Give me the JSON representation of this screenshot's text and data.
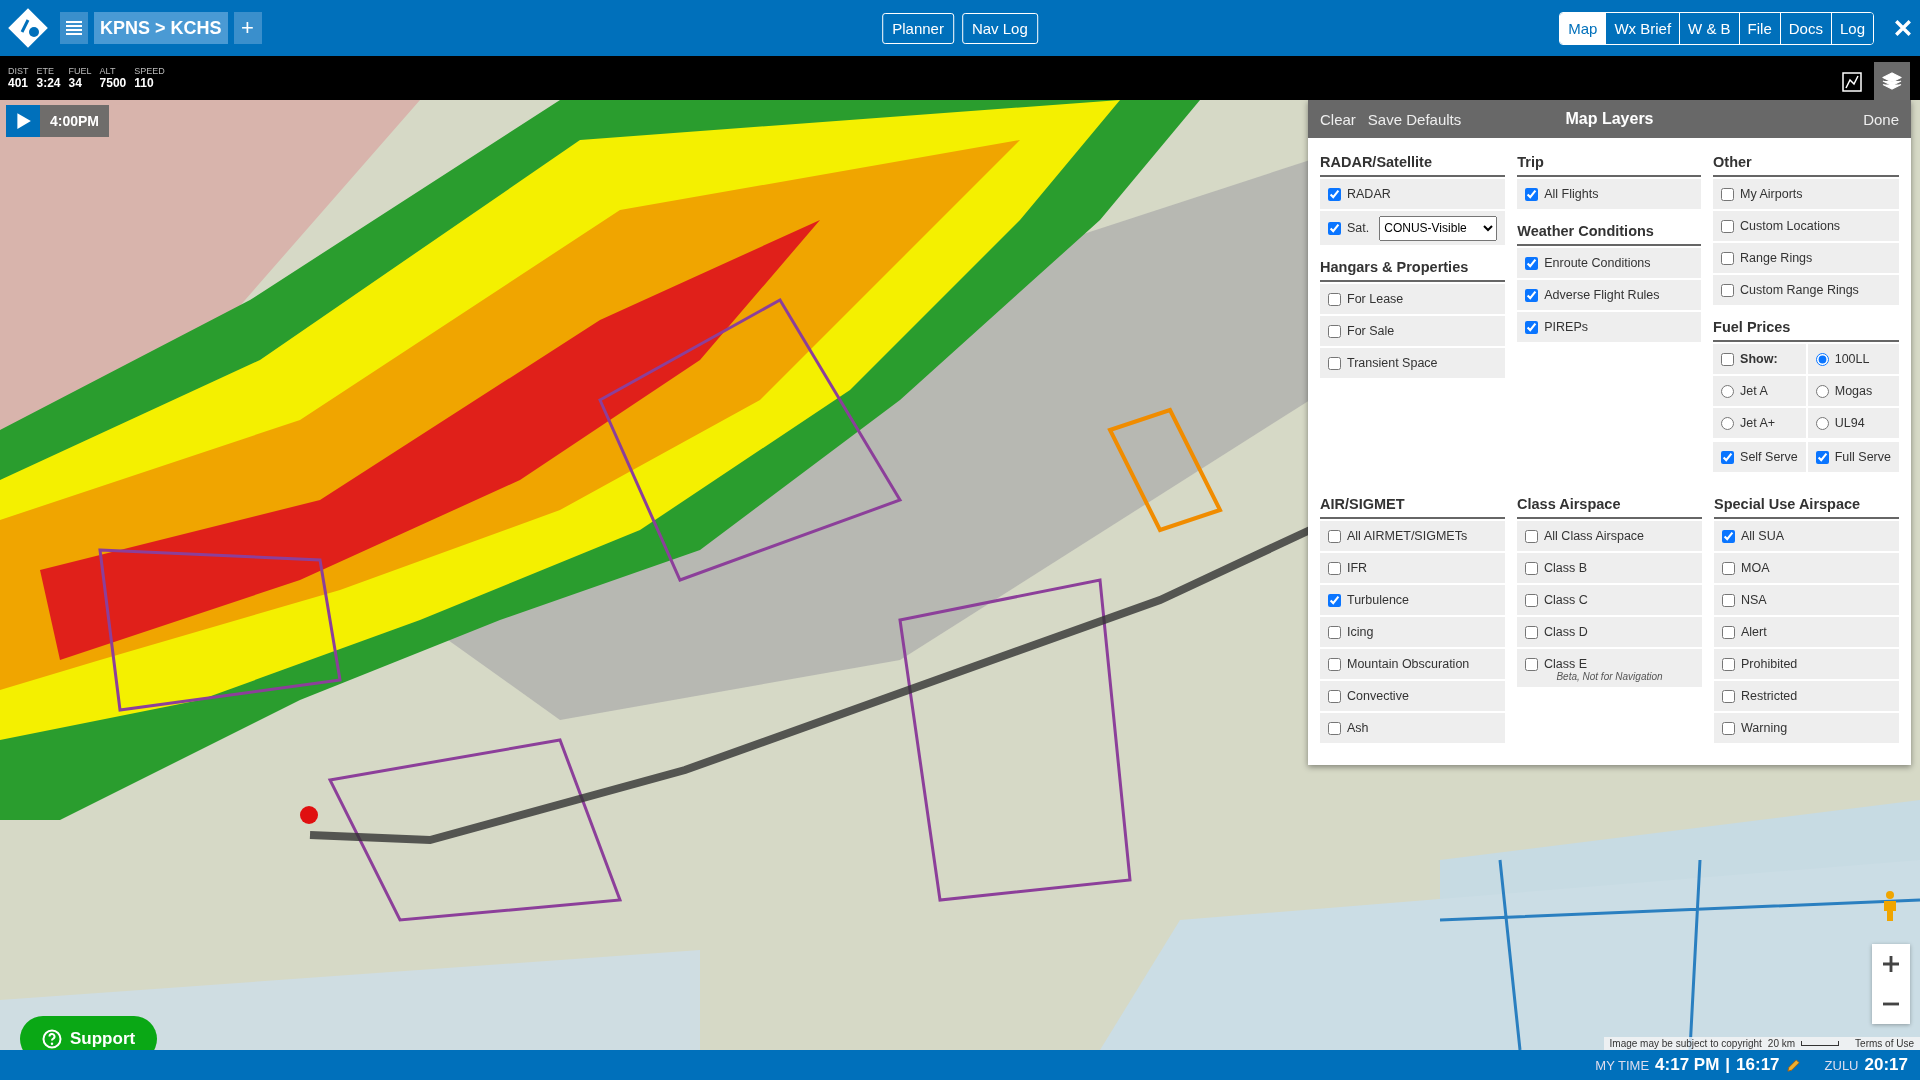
{
  "top_bar": {
    "route": "KPNS > KCHS",
    "add_label": "+",
    "center_buttons": [
      "Planner",
      "Nav Log"
    ],
    "tabs": [
      {
        "label": "Map",
        "selected": true
      },
      {
        "label": "Wx Brief",
        "selected": false
      },
      {
        "label": "W & B",
        "selected": false
      },
      {
        "label": "File",
        "selected": false
      },
      {
        "label": "Docs",
        "selected": false
      },
      {
        "label": "Log",
        "selected": false
      }
    ]
  },
  "stats": [
    {
      "label": "DIST",
      "value": "401"
    },
    {
      "label": "ETE",
      "value": "3:24"
    },
    {
      "label": "FUEL",
      "value": "34"
    },
    {
      "label": "ALT",
      "value": "7500"
    },
    {
      "label": "SPEED",
      "value": "110"
    }
  ],
  "toolbar": {
    "layers_active": true
  },
  "playback": {
    "time": "4:00PM"
  },
  "map_layers": {
    "title": "Map Layers",
    "actions": [
      "Clear",
      "Save Defaults"
    ],
    "done": "Done",
    "top_columns": [
      [
        {
          "title": "RADAR/Satellite",
          "kind": "list",
          "items": [
            {
              "kind": "checkbox",
              "label": "RADAR",
              "checked": true
            },
            {
              "kind": "select",
              "label": "Sat.",
              "checked": true,
              "value": "CONUS-Visible"
            }
          ]
        },
        {
          "title": "Hangars & Properties",
          "kind": "list",
          "items": [
            {
              "kind": "checkbox",
              "label": "For Lease",
              "checked": false
            },
            {
              "kind": "checkbox",
              "label": "For Sale",
              "checked": false
            },
            {
              "kind": "checkbox",
              "label": "Transient Space",
              "checked": false
            }
          ]
        }
      ],
      [
        {
          "title": "Trip",
          "kind": "list",
          "items": [
            {
              "kind": "checkbox",
              "label": "All Flights",
              "checked": true
            }
          ]
        },
        {
          "title": "Weather Conditions",
          "kind": "list",
          "items": [
            {
              "kind": "checkbox",
              "label": "Enroute Conditions",
              "checked": true
            },
            {
              "kind": "checkbox",
              "label": "Adverse Flight Rules",
              "checked": true
            },
            {
              "kind": "checkbox",
              "label": "PIREPs",
              "checked": true
            }
          ]
        }
      ],
      [
        {
          "title": "Other",
          "kind": "list",
          "items": [
            {
              "kind": "checkbox",
              "label": "My Airports",
              "checked": false
            },
            {
              "kind": "checkbox",
              "label": "Custom Locations",
              "checked": false
            },
            {
              "kind": "checkbox",
              "label": "Range Rings",
              "checked": false
            },
            {
              "kind": "checkbox",
              "label": "Custom Range Rings",
              "checked": false
            }
          ]
        },
        {
          "title": "Fuel Prices",
          "kind": "fuel",
          "show": {
            "label": "Show:",
            "checked": false
          },
          "fuel_types": [
            {
              "label": "100LL",
              "selected": true
            },
            {
              "label": "Jet A",
              "selected": false
            },
            {
              "label": "Mogas",
              "selected": false
            },
            {
              "label": "Jet A+",
              "selected": false
            },
            {
              "label": "UL94",
              "selected": false
            }
          ],
          "service": [
            {
              "label": "Self Serve",
              "checked": true
            },
            {
              "label": "Full Serve",
              "checked": true
            }
          ]
        }
      ]
    ],
    "bottom_columns": [
      [
        {
          "title": "AIR/SIGMET",
          "kind": "list",
          "items": [
            {
              "kind": "checkbox",
              "label": "All AIRMET/SIGMETs",
              "checked": false
            },
            {
              "kind": "checkbox",
              "label": "IFR",
              "checked": false
            },
            {
              "kind": "checkbox",
              "label": "Turbulence",
              "checked": true
            },
            {
              "kind": "checkbox",
              "label": "Icing",
              "checked": false
            },
            {
              "kind": "checkbox",
              "label": "Mountain Obscuration",
              "checked": false
            },
            {
              "kind": "checkbox",
              "label": "Convective",
              "checked": false
            },
            {
              "kind": "checkbox",
              "label": "Ash",
              "checked": false
            }
          ]
        }
      ],
      [
        {
          "title": "Class Airspace",
          "kind": "list",
          "items": [
            {
              "kind": "checkbox",
              "label": "All Class Airspace",
              "checked": false
            },
            {
              "kind": "checkbox",
              "label": "Class B",
              "checked": false
            },
            {
              "kind": "checkbox",
              "label": "Class C",
              "checked": false
            },
            {
              "kind": "checkbox",
              "label": "Class D",
              "checked": false
            },
            {
              "kind": "checkbox",
              "label": "Class E",
              "checked": false,
              "note": "Beta, Not for Navigation"
            }
          ]
        }
      ],
      [
        {
          "title": "Special Use Airspace",
          "kind": "list",
          "items": [
            {
              "kind": "checkbox",
              "label": "All SUA",
              "checked": true
            },
            {
              "kind": "checkbox",
              "label": "MOA",
              "checked": false
            },
            {
              "kind": "checkbox",
              "label": "NSA",
              "checked": false
            },
            {
              "kind": "checkbox",
              "label": "Alert",
              "checked": false
            },
            {
              "kind": "checkbox",
              "label": "Prohibited",
              "checked": false
            },
            {
              "kind": "checkbox",
              "label": "Restricted",
              "checked": false
            },
            {
              "kind": "checkbox",
              "label": "Warning",
              "checked": false
            }
          ]
        }
      ]
    ]
  },
  "support": "Support",
  "attribution": {
    "copyright": "Image may be subject to copyright",
    "scale": "20 km",
    "terms": "Terms of Use"
  },
  "status_bar": {
    "my_time_label": "MY TIME",
    "local_time": "4:17 PM",
    "separator": "|",
    "time_24": "16:17",
    "zulu_label": "ZULU",
    "zulu_time": "20:17"
  }
}
